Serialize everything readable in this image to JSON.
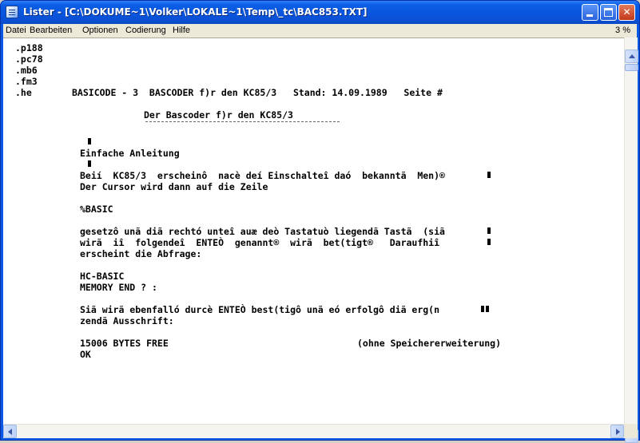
{
  "window": {
    "title": "Lister - [C:\\DOKUME~1\\Volker\\LOKALE~1\\Temp\\_tc\\BAC853.TXT]",
    "colors": {
      "titlebar": "#0a55dc",
      "close_button": "#c1381a",
      "menubar": "#ece9d8"
    }
  },
  "menu": {
    "items": [
      "Datei",
      "Bearbeiten",
      "Optionen",
      "Codierung",
      "Hilfe"
    ],
    "percent": "3 %"
  },
  "content": {
    "lines": [
      ".p188",
      ".pc78",
      ".mb6",
      ".fm3",
      ".he",
      "BASICODE - 3  BASCODER f)r den KC85/3   Stand: 14.09.1989   Seite #",
      "Der Bascoder f)r den KC85/3",
      "Einfache Anleitung",
      "Beií  KC85/3  erscheinô  nacè deí Einschalteî daó  bekanntã  Men)® ",
      "Der Cursor wird dann auf die Zeile",
      "%BASIC",
      "gesetzô unã diã rechtó unteî auæ deò Tastatuò liegendã Tastã  (siã ",
      "wirã  iî  folgendeî  ENTEÒ  genannt®  wirã  bet(tigt®   Daraufhiî ",
      "erscheint die Abfrage:",
      "HC-BASIC",
      "MEMORY END ? :",
      "Siã wirã ebenfalló durcè ENTEÒ best(tigô unã eó erfolgô diã erg(n",
      "zendã Ausschrift:",
      "15006 BYTES FREE",
      "(ohne Speichererweiterung)",
      "OK"
    ]
  },
  "scrollbars": {
    "vertical_position_fraction": 0.03
  }
}
